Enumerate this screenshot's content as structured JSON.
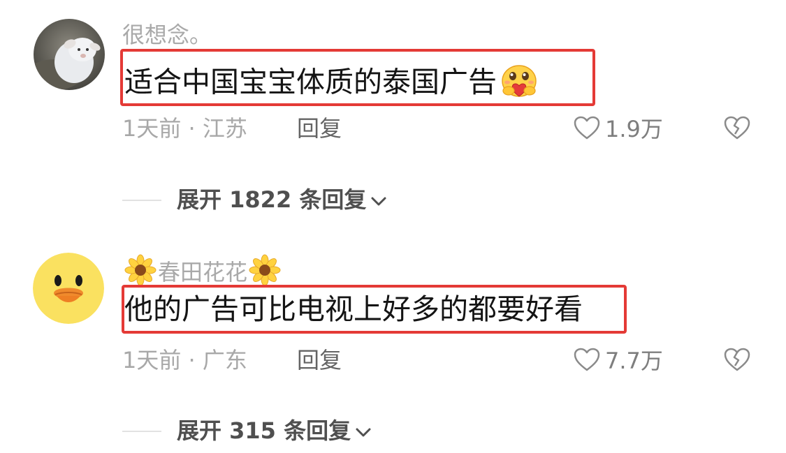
{
  "comments": [
    {
      "username": "很想念。",
      "avatar_icon": "lamb-avatar",
      "text": "适合中国宝宝体质的泰国广告",
      "emoji": "hugging-heart-emoji",
      "time_location": "1天前 · 江苏",
      "reply_label": "回复",
      "likes": "1.9万",
      "expand_label": "展开 1822 条回复"
    },
    {
      "username": "春田花花",
      "avatar_icon": "yellow-chick-avatar",
      "username_decoration": "sunflower-icon",
      "text": "他的广告可比电视上好多的都要好看",
      "time_location": "1天前 · 广东",
      "reply_label": "回复",
      "likes": "7.7万",
      "expand_label": "展开 315 条回复"
    }
  ],
  "colors": {
    "highlight_box": "#e43a36",
    "muted_text": "#a8a8a8",
    "body_text": "#141414"
  }
}
